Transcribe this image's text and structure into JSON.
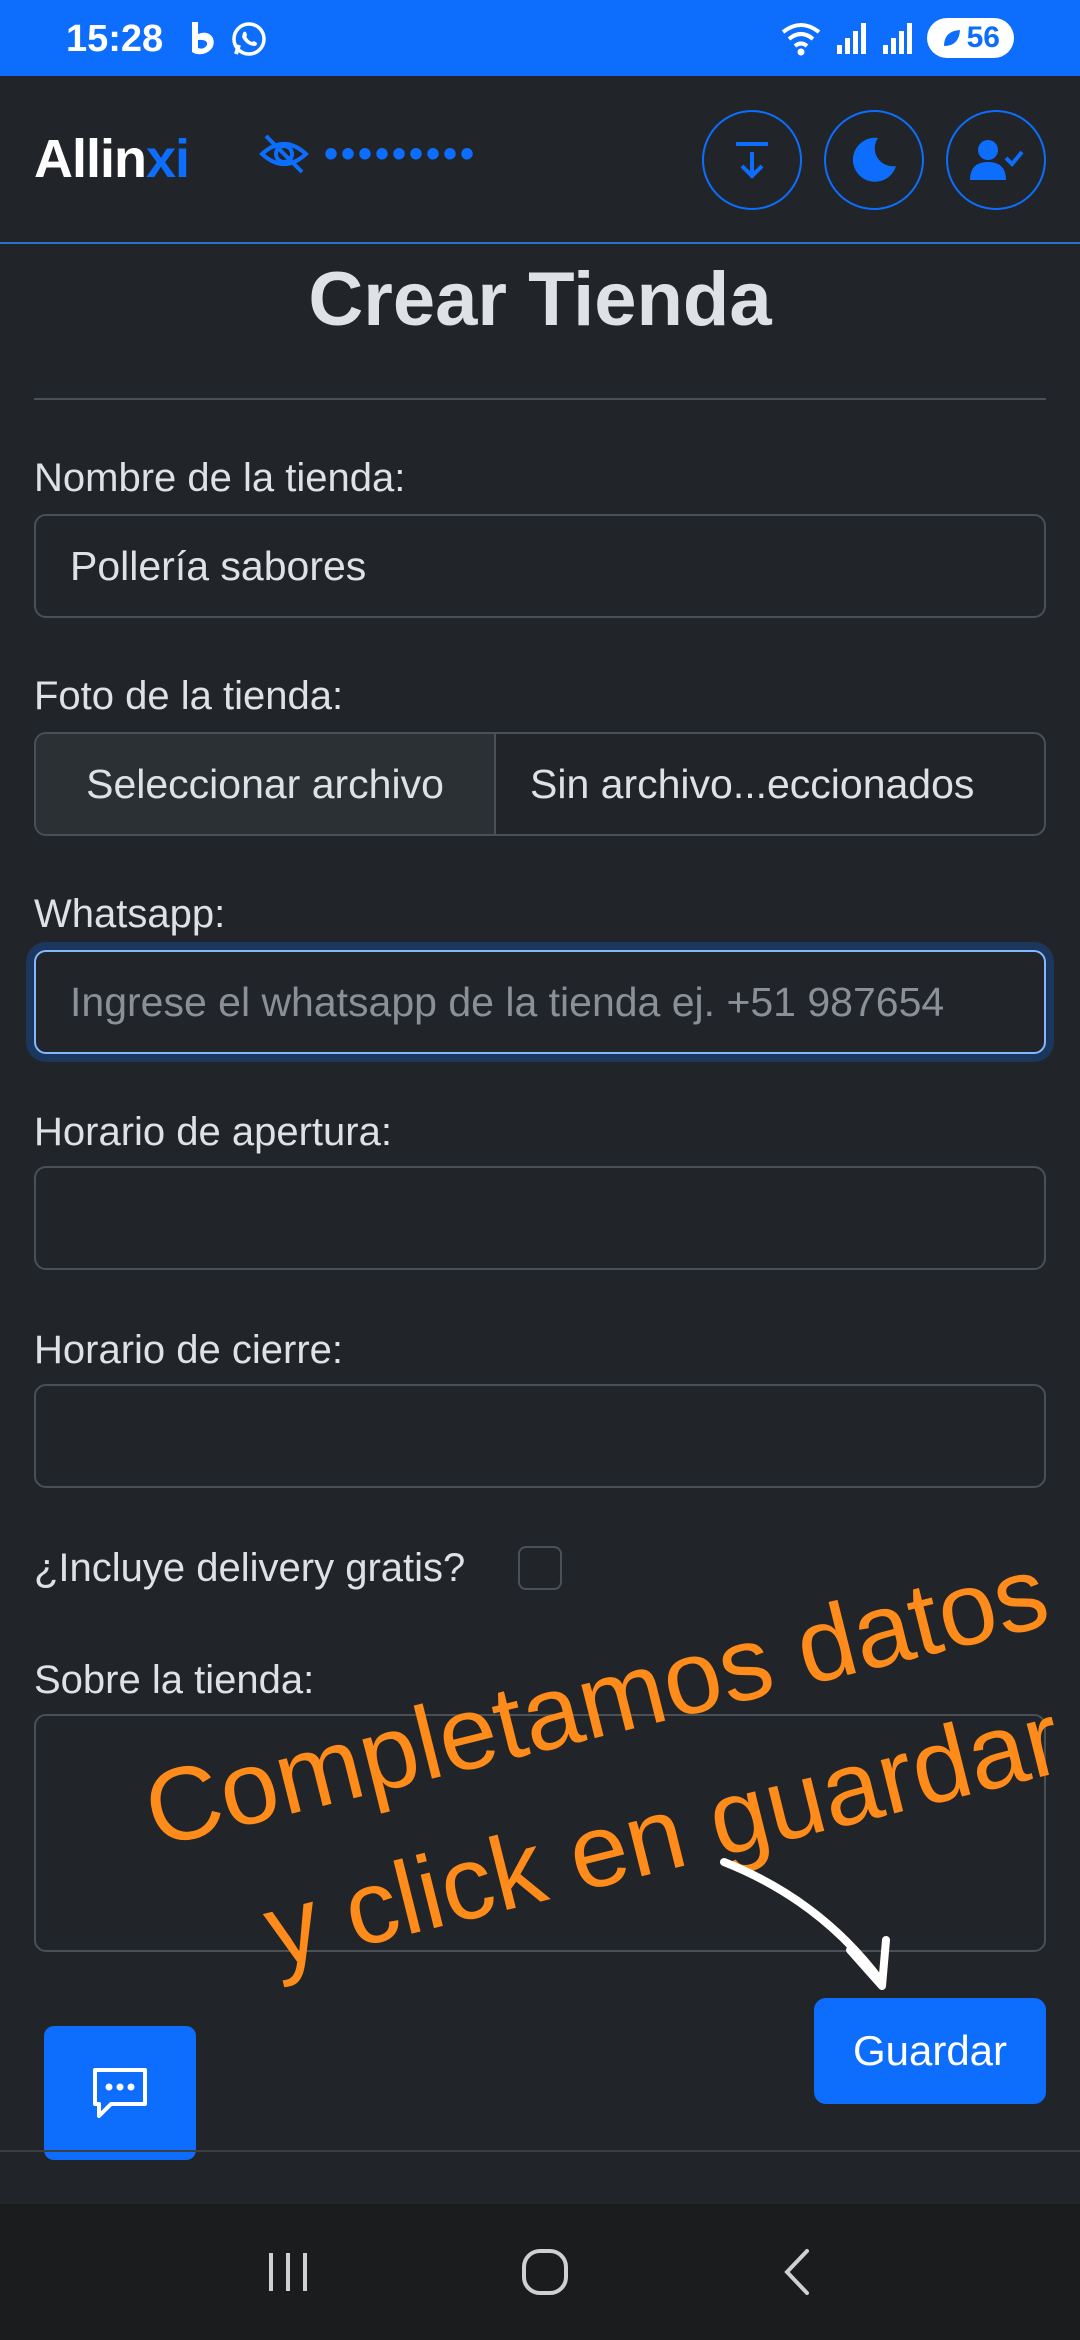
{
  "status_bar": {
    "time": "15:28",
    "battery": "56"
  },
  "navbar": {
    "brand_main": "Allin",
    "brand_accent": "xi",
    "privacy_dots": "•••••••••",
    "buttons": [
      "download-icon",
      "moon-icon",
      "user-check-icon"
    ]
  },
  "form": {
    "title": "Crear Tienda",
    "name_label": "Nombre de la tienda:",
    "name_value": "Pollería sabores",
    "photo_label": "Foto de la tienda:",
    "file_button": "Seleccionar archivo",
    "file_status": "Sin archivo...eccionados",
    "whatsapp_label": "Whatsapp:",
    "whatsapp_placeholder": "Ingrese el whatsapp de la tienda ej. +51 987654",
    "open_label": "Horario de apertura:",
    "close_label": "Horario de cierre:",
    "delivery_label": "¿Incluye delivery gratis?",
    "delivery_checked": false,
    "about_label": "Sobre la tienda:",
    "save_label": "Guardar"
  },
  "annotation": {
    "line1": "Completamos datos",
    "line2": "y click en guardar",
    "color": "#ff8c1a"
  },
  "colors": {
    "primary": "#0d6efd",
    "background": "#212529"
  }
}
